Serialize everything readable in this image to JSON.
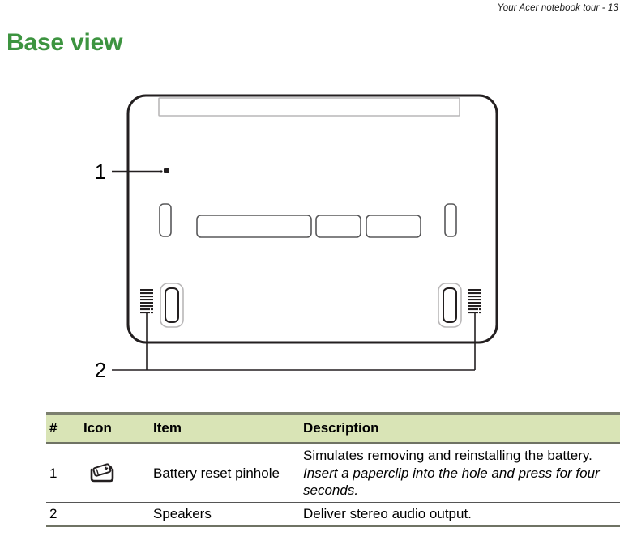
{
  "header": {
    "running_head": "Your Acer notebook tour - 13"
  },
  "section": {
    "title": "Base view",
    "title_color": "#3d9440"
  },
  "figure": {
    "name": "base-view-diagram",
    "callouts": [
      {
        "label": "1",
        "target": "battery-reset-pinhole"
      },
      {
        "label": "2",
        "target": "speakers"
      }
    ],
    "parts": [
      "chassis-outline",
      "top-panel-bar",
      "left-side-slot",
      "right-side-slot",
      "vent-wide",
      "vent-narrow",
      "vent-medium",
      "pinhole",
      "left-speaker-grille",
      "right-speaker-grille",
      "left-rubber-foot",
      "right-rubber-foot"
    ]
  },
  "table": {
    "name": "base-view-components-table",
    "header_bg": "#d9e4b6",
    "columns": [
      "#",
      "Icon",
      "Item",
      "Description"
    ],
    "rows": [
      {
        "num": "1",
        "icon": "battery-reset-icon",
        "item": "Battery reset pinhole",
        "desc_plain": "Simulates removing and reinstalling the battery.",
        "desc_italic": "Insert a paperclip into the hole and press for four seconds."
      },
      {
        "num": "2",
        "icon": "",
        "item": "Speakers",
        "desc_plain": "Deliver stereo audio output.",
        "desc_italic": ""
      }
    ]
  }
}
